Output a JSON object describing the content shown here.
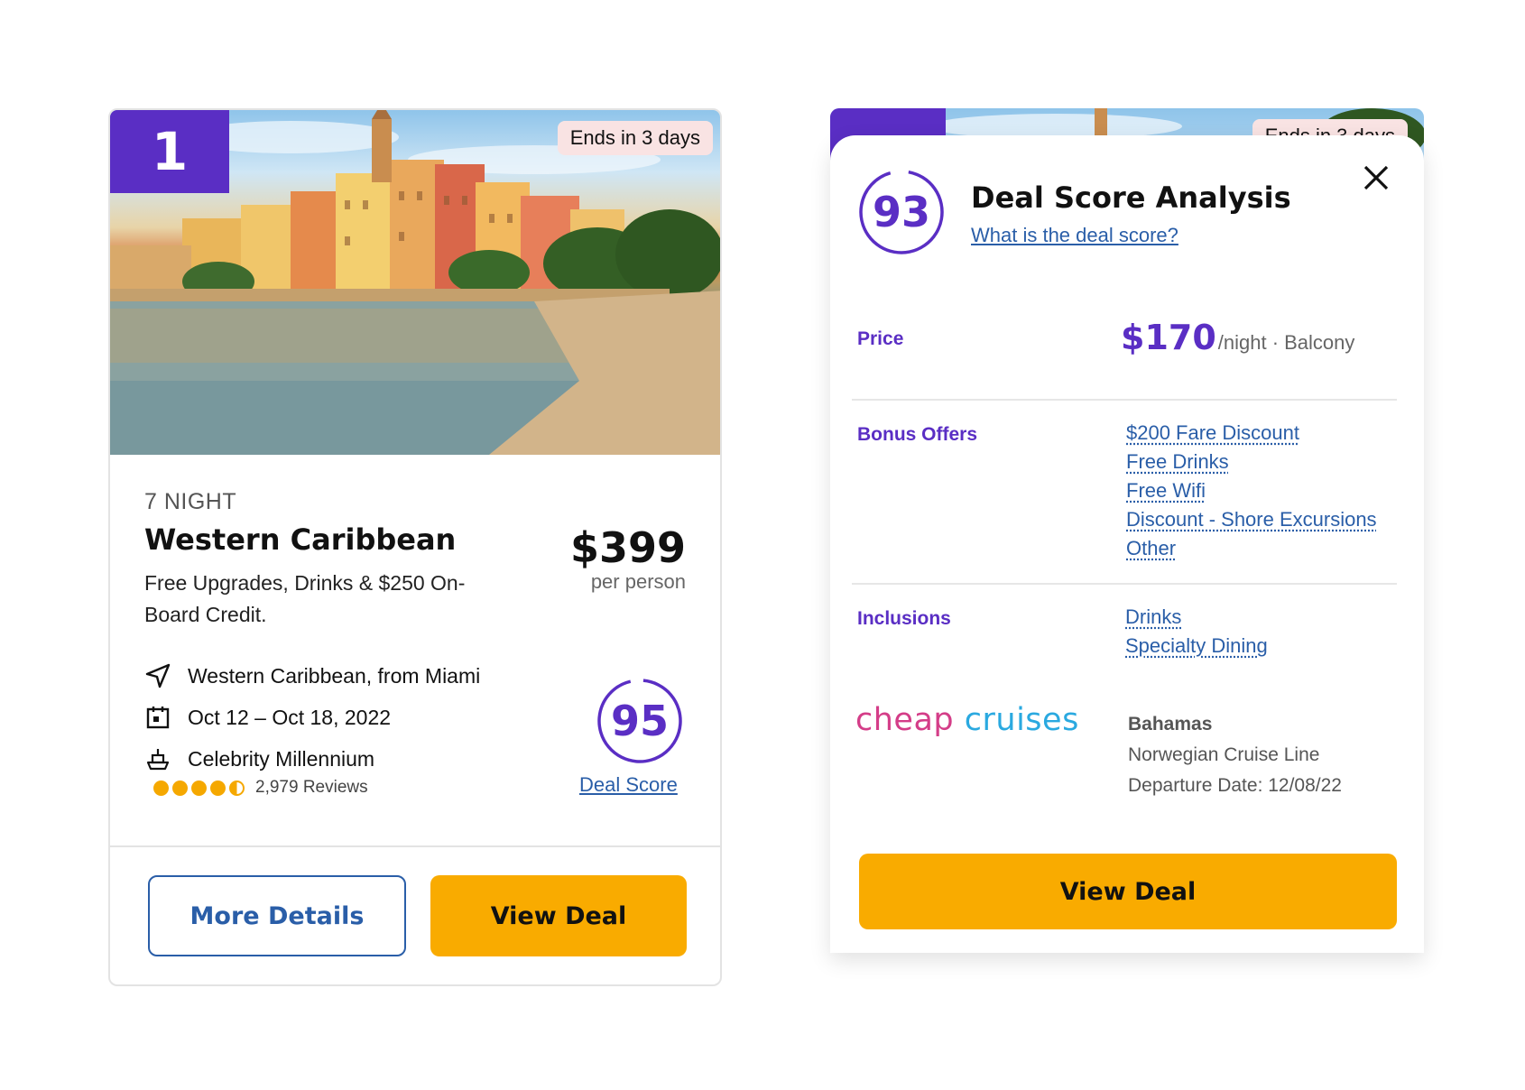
{
  "card": {
    "rank": "1",
    "ends_badge": "Ends in 3 days",
    "nights": "7 NIGHT",
    "title": "Western Caribbean",
    "subtitle": "Free Upgrades, Drinks & $250 On-Board Credit.",
    "price": "$399",
    "price_unit": "per person",
    "itinerary": "Western Caribbean, from Miami",
    "dates": "Oct 12 – Oct 18, 2022",
    "ship": "Celebrity Millennium",
    "rating": 4.5,
    "rating_max": 5,
    "reviews": "2,979 Reviews",
    "deal_score": "95",
    "deal_score_link": "Deal Score",
    "more_details_label": "More Details",
    "view_deal_label": "View Deal"
  },
  "modal": {
    "score": "93",
    "title": "Deal Score Analysis",
    "help_link": "What is the deal score?",
    "price_label": "Price",
    "price_value": "$170",
    "price_suffix": "/night · Balcony",
    "bonus_label": "Bonus Offers",
    "bonus_offers": [
      "$200 Fare Discount",
      "Free Drinks",
      "Free Wifi",
      "Discount - Shore Excursions",
      "Other"
    ],
    "inclusions_label": "Inclusions",
    "inclusions": [
      "Drinks",
      "Specialty Dining"
    ],
    "provider_logo_part1": "cheap",
    "provider_logo_part2": "cruises",
    "destination": "Bahamas",
    "cruise_line": "Norwegian Cruise Line",
    "departure": "Departure Date: 12/08/22",
    "view_deal_label": "View Deal"
  },
  "colors": {
    "accent_purple": "#5a2ec4",
    "link_blue": "#2a5ea8",
    "button_yellow": "#f9ab00",
    "star_yellow": "#f5a800",
    "logo_pink": "#d43d88",
    "logo_blue": "#2aa9e0"
  }
}
